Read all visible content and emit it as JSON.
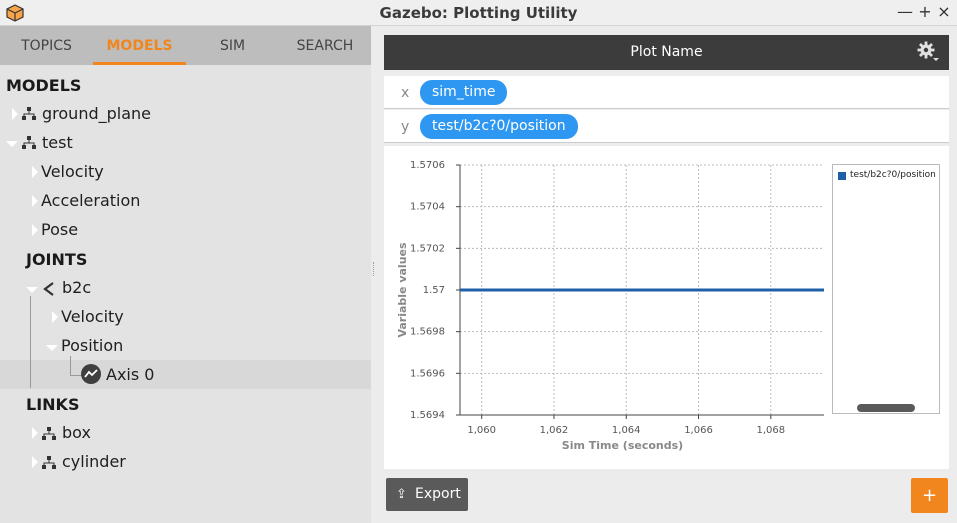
{
  "window": {
    "title": "Gazebo: Plotting Utility",
    "controls": {
      "minimize": "—",
      "maximize": "+",
      "close": "×"
    }
  },
  "tabs": [
    {
      "label": "TOPICS"
    },
    {
      "label": "MODELS"
    },
    {
      "label": "SIM"
    },
    {
      "label": "SEARCH"
    }
  ],
  "tree": {
    "models_header": "MODELS",
    "ground_plane": "ground_plane",
    "test": "test",
    "velocity": "Velocity",
    "acceleration": "Acceleration",
    "pose": "Pose",
    "joints_header": "JOINTS",
    "joint_b2c": "b2c",
    "joint_velocity": "Velocity",
    "joint_position": "Position",
    "axis0": "Axis 0",
    "links_header": "LINKS",
    "link_box": "box",
    "link_cylinder": "cylinder"
  },
  "plot": {
    "name": "Plot Name",
    "x_axis_letter": "x",
    "y_axis_letter": "y",
    "x_variable": "sim_time",
    "y_variable": "test/b2c?0/position"
  },
  "buttons": {
    "export": "Export",
    "add": "+"
  },
  "colors": {
    "accent": "#f0861d",
    "pill": "#2e97f1",
    "series": "#1f5fa8",
    "header": "#3c3c3c"
  },
  "chart_data": {
    "type": "line",
    "xlabel": "Sim Time (seconds)",
    "ylabel": "Variable values",
    "xlim": [
      1059.4,
      1069.5
    ],
    "ylim": [
      1.5694,
      1.5706
    ],
    "x_ticks": [
      "1,060",
      "1,062",
      "1,064",
      "1,066",
      "1,068"
    ],
    "x_tick_values": [
      1060,
      1062,
      1064,
      1066,
      1068
    ],
    "y_ticks": [
      "1.5694",
      "1.5696",
      "1.5698",
      "1.57",
      "1.5702",
      "1.5704",
      "1.5706"
    ],
    "y_tick_values": [
      1.5694,
      1.5696,
      1.5698,
      1.57,
      1.5702,
      1.5704,
      1.5706
    ],
    "grid": true,
    "legend": "right",
    "series": [
      {
        "name": "test/b2c?0/position",
        "x": [
          1059.4,
          1069.5
        ],
        "y": [
          1.57,
          1.57
        ]
      }
    ]
  }
}
